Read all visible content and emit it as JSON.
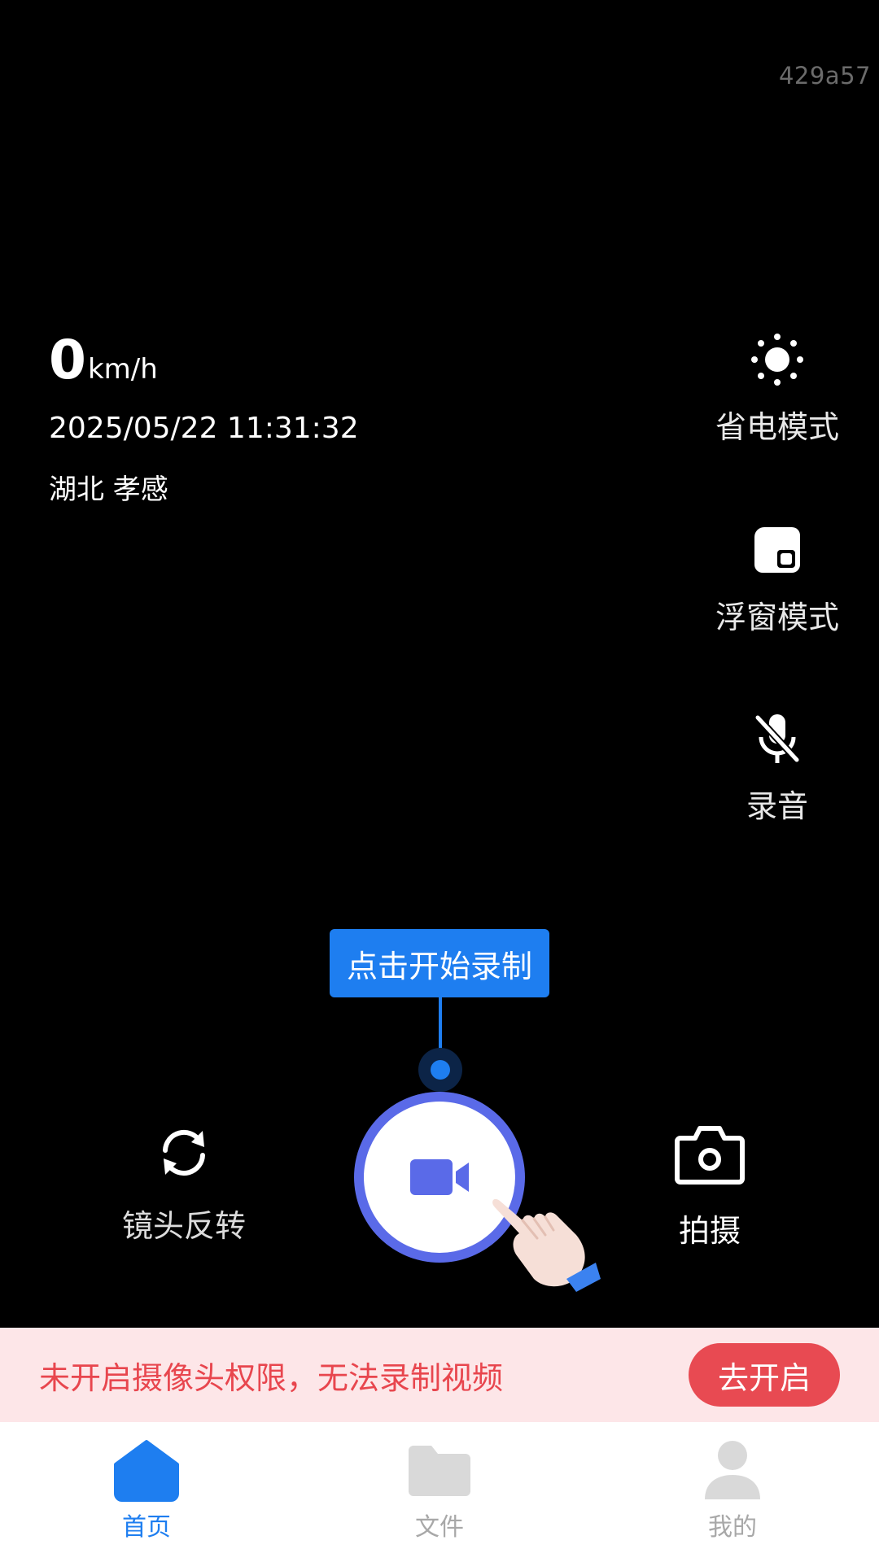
{
  "overlay": {
    "build_id": "429a57",
    "speed_value": "0",
    "speed_unit": "km/h",
    "datetime": "2025/05/22 11:31:32",
    "location": "湖北 孝感"
  },
  "side_controls": {
    "power_saving": {
      "label": "省电模式",
      "icon": "sun-icon"
    },
    "floating_window": {
      "label": "浮窗模式",
      "icon": "floating-window-icon"
    },
    "audio": {
      "label": "录音",
      "icon": "mic-off-icon"
    }
  },
  "tooltip": {
    "text": "点击开始录制"
  },
  "camera_controls": {
    "flip": {
      "label": "镜头反转",
      "icon": "camera-flip-icon"
    },
    "record": {
      "icon": "video-camera-icon"
    },
    "photo": {
      "label": "拍摄",
      "icon": "camera-icon"
    }
  },
  "permission_banner": {
    "message": "未开启摄像头权限，无法录制视频",
    "button_label": "去开启"
  },
  "bottom_nav": {
    "items": [
      {
        "label": "首页",
        "icon": "home-icon",
        "active": true
      },
      {
        "label": "文件",
        "icon": "folder-icon",
        "active": false
      },
      {
        "label": "我的",
        "icon": "profile-icon",
        "active": false
      }
    ]
  },
  "colors": {
    "accent": "#1e7ef0",
    "record_ring": "#5a6ae8",
    "warning_text": "#e8464e",
    "warning_bg": "#fde6e8",
    "warning_button": "#e84a52",
    "inactive_nav": "#d9d9d9"
  }
}
